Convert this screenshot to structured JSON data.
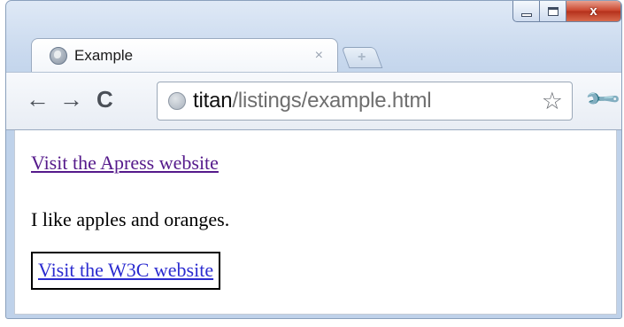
{
  "window": {
    "controls": {
      "minimize": "",
      "maximize": "",
      "close": "x"
    }
  },
  "tabs": [
    {
      "title": "Example",
      "close_label": "×",
      "icon": "globe-icon"
    }
  ],
  "new_tab": {
    "label": "+"
  },
  "toolbar": {
    "back_label": "←",
    "forward_label": "→",
    "reload_label": "C",
    "bookmark_label": "☆",
    "wrench_label": "🔧",
    "address": {
      "host": "titan",
      "path": "/listings/example.html"
    }
  },
  "page": {
    "link1": "Visit the Apress website",
    "paragraph": "I like apples and oranges.",
    "link2": "Visit the W3C website"
  },
  "colors": {
    "visited_link": "#551a8b",
    "link": "#2b2bd0",
    "close_button": "#c9432a"
  }
}
